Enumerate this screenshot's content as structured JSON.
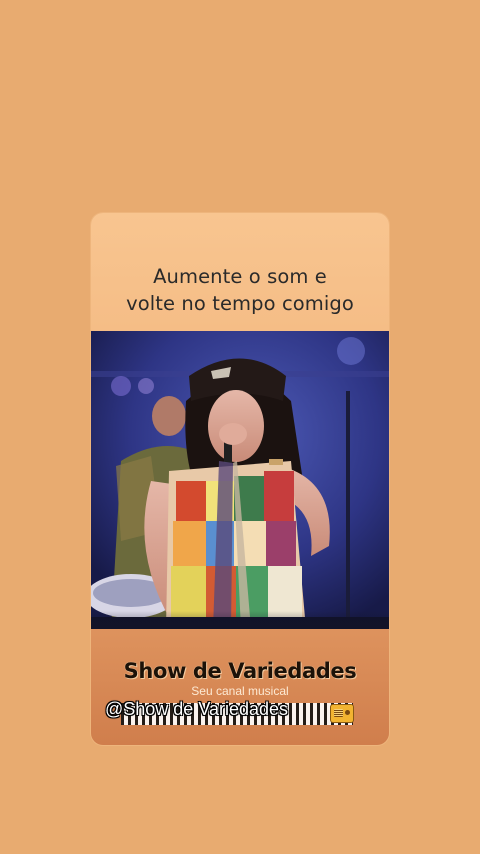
{
  "caption": {
    "line1": "Aumente o som e",
    "line2": "volte no tempo comigo"
  },
  "video": {
    "description_icon": "concert-video-thumbnail"
  },
  "branding": {
    "title": "Show de Variedades",
    "tagline": "Seu canal musical",
    "handle": "@Show de Variedades",
    "handle_icon": "radio-icon"
  },
  "colors": {
    "background": "#E8AB70",
    "card_top": "#F8C590",
    "card_bottom": "#D07E4C",
    "video_bg": "#2b3278"
  }
}
